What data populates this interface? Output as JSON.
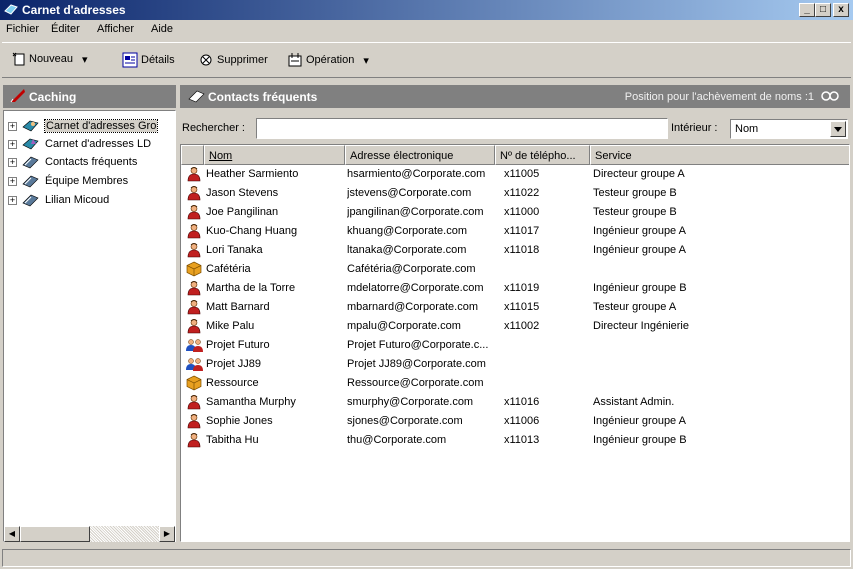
{
  "window": {
    "title": "Carnet d'adresses",
    "minimize": "_",
    "maximize": "□",
    "close": "x"
  },
  "menu": {
    "items": [
      "Fichier",
      "Éditer",
      "Afficher",
      "Aide"
    ]
  },
  "toolbar": {
    "new_label": "Nouveau",
    "details_label": "Détails",
    "delete_label": "Supprimer",
    "operation_label": "Opération",
    "dropdown_glyph": "▾"
  },
  "left_panel": {
    "title": "Caching",
    "tree": [
      {
        "label": "Carnet d'adresses Gro",
        "icon": "address-book-icon",
        "selected": true
      },
      {
        "label": "Carnet d'adresses LD",
        "icon": "ldap-book-icon",
        "selected": false
      },
      {
        "label": "Contacts fréquents",
        "icon": "book-icon",
        "selected": false
      },
      {
        "label": "Équipe Membres",
        "icon": "book-icon",
        "selected": false
      },
      {
        "label": "Lilian Micoud",
        "icon": "book-icon",
        "selected": false
      }
    ],
    "scroll_left": "◀",
    "scroll_right": "▶"
  },
  "right_panel": {
    "title": "Contacts fréquents",
    "completion_text": "Position pour l'achèvement de noms :1",
    "search_label": "Rechercher :",
    "search_value": "",
    "inside_label": "Intérieur :",
    "inside_value": "Nom"
  },
  "columns": [
    "Nom",
    "Adresse électronique",
    "Nº de télépho...",
    "Service"
  ],
  "contacts": [
    {
      "type": "person",
      "name": "Heather Sarmiento",
      "email": "hsarmiento@Corporate.com",
      "phone": "x11005",
      "service": "Directeur groupe A"
    },
    {
      "type": "person",
      "name": "Jason Stevens",
      "email": "jstevens@Corporate.com",
      "phone": "x11022",
      "service": "Testeur groupe B"
    },
    {
      "type": "person",
      "name": "Joe Pangilinan",
      "email": "jpangilinan@Corporate.com",
      "phone": "x11000",
      "service": "Testeur groupe B"
    },
    {
      "type": "person",
      "name": "Kuo-Chang Huang",
      "email": "khuang@Corporate.com",
      "phone": "x11017",
      "service": "Ingénieur groupe A"
    },
    {
      "type": "person",
      "name": "Lori Tanaka",
      "email": "ltanaka@Corporate.com",
      "phone": "x11018",
      "service": "Ingénieur groupe A"
    },
    {
      "type": "resource",
      "name": "Cafétéria",
      "email": "Cafétéria@Corporate.com",
      "phone": "",
      "service": ""
    },
    {
      "type": "person",
      "name": "Martha de la Torre",
      "email": "mdelatorre@Corporate.com",
      "phone": "x11019",
      "service": "Ingénieur groupe B"
    },
    {
      "type": "person",
      "name": "Matt Barnard",
      "email": "mbarnard@Corporate.com",
      "phone": "x11015",
      "service": "Testeur groupe A"
    },
    {
      "type": "person",
      "name": "Mike Palu",
      "email": "mpalu@Corporate.com",
      "phone": "x11002",
      "service": "Directeur Ingénierie"
    },
    {
      "type": "group",
      "name": "Projet Futuro",
      "email": "Projet Futuro@Corporate.c...",
      "phone": "",
      "service": ""
    },
    {
      "type": "group",
      "name": "Projet JJ89",
      "email": "Projet JJ89@Corporate.com",
      "phone": "",
      "service": ""
    },
    {
      "type": "resource",
      "name": "Ressource",
      "email": "Ressource@Corporate.com",
      "phone": "",
      "service": ""
    },
    {
      "type": "person",
      "name": "Samantha Murphy",
      "email": "smurphy@Corporate.com",
      "phone": "x11016",
      "service": "Assistant Admin."
    },
    {
      "type": "person",
      "name": "Sophie Jones",
      "email": "sjones@Corporate.com",
      "phone": "x11006",
      "service": "Ingénieur groupe A"
    },
    {
      "type": "person",
      "name": "Tabitha Hu",
      "email": "thu@Corporate.com",
      "phone": "x11013",
      "service": "Ingénieur groupe B"
    }
  ]
}
